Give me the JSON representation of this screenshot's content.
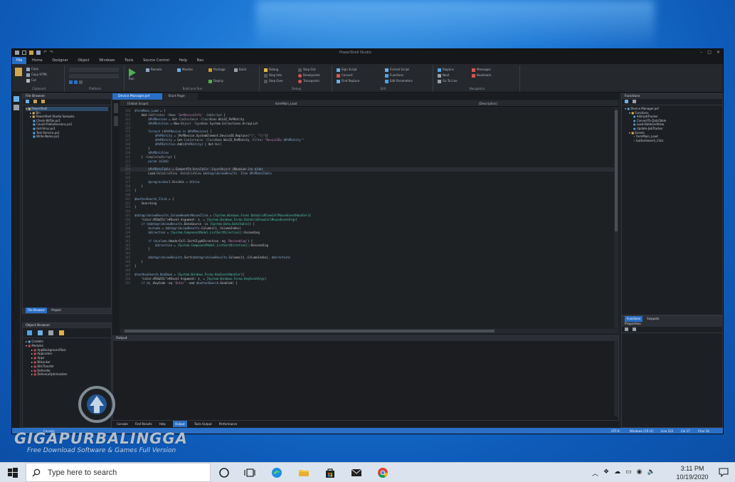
{
  "window": {
    "title": "PowerShell Studio"
  },
  "menu": [
    "File",
    "Home",
    "Designer",
    "Object",
    "Windows",
    "Tools",
    "Source Control",
    "Help",
    "Nav"
  ],
  "ribbon_groups": [
    "Clipboard",
    "Platform",
    "Build and Run",
    "Debug",
    "Edit",
    "Navigation"
  ],
  "ribbon_items": {
    "clipboard": [
      "Copy",
      "Copy HTML",
      "Cut"
    ],
    "build": [
      "Run",
      "Remote",
      "Monitor",
      "Package",
      "Build",
      "Deploy"
    ],
    "debug": [
      "Debug",
      "Step Into",
      "Step Over",
      "Step Out",
      "Breakpoints",
      "Tracepoints"
    ],
    "edit": [
      "Sign Script",
      "Convert",
      "Find Replace",
      "Format Script",
      "Functions",
      "Edit Parameters"
    ],
    "navigation": [
      "Regions",
      "Messages",
      "Bookmark",
      "Next",
      "Go To Line"
    ]
  },
  "tabs": [
    "Device Manager.psf",
    "Start Page"
  ],
  "function_bar": {
    "left": "[Global Scope]",
    "middle": "formMain_Load",
    "right": "[Description]"
  },
  "left_panel": {
    "title": "File Browser",
    "tree": [
      "PowerShell",
      "Bin",
      "PowerShell Studio Samples",
      "Check-WiFile.ps1",
      "Count-FileExtensions.ps1",
      "Get-Virus.ps1",
      "Test-Service.ps1",
      "Write-Name.ps1"
    ],
    "bottom_tabs": [
      "File Browser",
      "Project"
    ]
  },
  "object_browser": {
    "title": "Object Browser",
    "tree": [
      "Cmdlets",
      "Modules",
      "AppBackgroundTask",
      "AppLocker",
      "Appx",
      "BitLocker",
      "BitsTransfer",
      "Defender",
      "DeliveryOptimization"
    ]
  },
  "functions_panel": {
    "title": "Functions",
    "tree": [
      "Device Manager.psf",
      "Functions",
      "Add-JobTracker",
      "ConvertTo-DataTable",
      "Load-DataGridView",
      "Update-JobTracker",
      "Events",
      "formMain_Load",
      "buttonSearch_Click"
    ]
  },
  "properties_panel": {
    "tabs": [
      "Functions",
      "Snippets"
    ],
    "title": "Properties"
  },
  "output_panel": {
    "title": "Output"
  },
  "bottom_tabs": [
    "Console",
    "Find Results",
    "Help",
    "Output",
    "Tools Output",
    "Performance"
  ],
  "code": [
    {
      "n": "110",
      "t": "$formMain_Load = {"
    },
    {
      "n": "111",
      "t": "    Add-JobTracker -Name 'GetDeviceInfo' -JobScript {"
    },
    {
      "n": "112",
      "t": "        $PnPDevices = Get-CimInstance -ClassName Win32_PnPEntity"
    },
    {
      "n": "113",
      "t": "        $PnPEntities = New-Object -TypeName System.Collections.ArrayList"
    },
    {
      "n": "114",
      "t": ""
    },
    {
      "n": "115",
      "t": "        foreach ($PnPDevice in $PnPDevices) {"
    },
    {
      "n": "116",
      "t": "            $PnPEntity = [PnPDevice.SystemElement.DeviceID.Replace(\"\\\", \"\\\\\")]"
    },
    {
      "n": "117",
      "t": "            $PnPEntity = Get-CimInstance -ClassName Win32_PnPEntity -Filter \"DeviceID='$PnPEntity'\""
    },
    {
      "n": "118",
      "t": "            $PnPEntities.Add($PnPEntity) | Out-Null"
    },
    {
      "n": "119",
      "t": "        }"
    },
    {
      "n": "120",
      "t": "        $PnPEntities"
    },
    {
      "n": "121",
      "t": "    } -CompletedScript {"
    },
    {
      "n": "122",
      "t": "        param ($Job)"
    },
    {
      "n": "123",
      "t": ""
    },
    {
      "n": "124",
      "t": "        $PnPDataTable = ConvertTo-DataTable -InputObject (Receive-Job $Job)"
    },
    {
      "n": "125",
      "t": "        Load-DataGridView -DataGridView $datagridviewResults -Item $PnPDataTable"
    },
    {
      "n": "126",
      "t": ""
    },
    {
      "n": "127",
      "t": "        $progressbar1.Visible = $false"
    },
    {
      "n": "128",
      "t": "    }"
    },
    {
      "n": "129",
      "t": "}"
    },
    {
      "n": "130",
      "t": ""
    },
    {
      "n": "131",
      "t": "$buttonSearch_Click = {"
    },
    {
      "n": "132",
      "t": "    Searching"
    },
    {
      "n": "133",
      "t": "}"
    },
    {
      "n": "134",
      "t": ""
    },
    {
      "n": "135",
      "t": "$datagridviewResults_ColumnHeaderMouseClick = [System.Windows.Forms.DataGridViewCellMouseEventHandler]{"
    },
    {
      "n": "136",
      "t": "    #Event Argument: $_ = [System.Windows.Forms.DataGridViewCellMouseEventArgs]"
    },
    {
      "n": "137",
      "t": "    if ($datagridviewResults.DataSource -is [System.Data.DataTable]) {"
    },
    {
      "n": "138",
      "t": "        $column = $datagridviewResults.Columns[$_.ColumnIndex]"
    },
    {
      "n": "139",
      "t": "        $direction = [System.ComponentModel.ListSortDirection]::Ascending"
    },
    {
      "n": "140",
      "t": ""
    },
    {
      "n": "141",
      "t": "        if ($column.HeaderCell.SortGlyphDirection -eq 'Descending') {"
    },
    {
      "n": "142",
      "t": "            $direction = [System.ComponentModel.ListSortDirection]::Descending"
    },
    {
      "n": "143",
      "t": "        }"
    },
    {
      "n": "144",
      "t": ""
    },
    {
      "n": "145",
      "t": "        $datagridviewResults.Sort($datagridviewResults.Columns[$_.ColumnIndex], $direction)"
    },
    {
      "n": "146",
      "t": "    }"
    },
    {
      "n": "147",
      "t": "}"
    },
    {
      "n": "148",
      "t": ""
    },
    {
      "n": "149",
      "t": "$textboxSearch_KeyDown = [System.Windows.Forms.KeyEventHandler]{"
    },
    {
      "n": "150",
      "t": "    #Event Argument: $_ = [System.Windows.Forms.KeyEventArgs]"
    },
    {
      "n": "151",
      "t": "    if ($_.KeyCode -eq 'Enter' -and $buttonSearch.Enabled) {"
    }
  ],
  "statusbar": {
    "left": "Console",
    "right": [
      "UTF-8",
      "Windows (CR LF)",
      "Line 122",
      "Col 17",
      "Char 16"
    ]
  },
  "watermark": {
    "brand": "GIGAPURBALINGGA",
    "tagline": "Free Download Software & Games Full Version"
  },
  "taskbar": {
    "search_placeholder": "Type here to search",
    "time": "3:11 PM",
    "date": "10/19/2020"
  },
  "colors": {
    "accent": "#2a6fc6",
    "editor_bg": "#1e2124",
    "keyword": "#6da6e8",
    "variable": "#8fb3d9",
    "string": "#c586c0",
    "comment": "#58a55c",
    "type": "#4ec9b0"
  }
}
